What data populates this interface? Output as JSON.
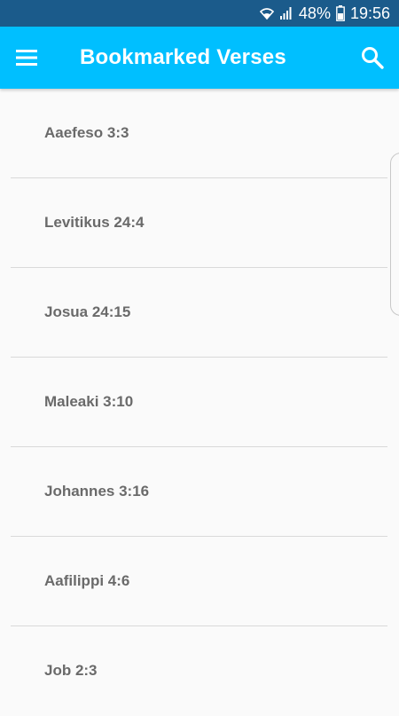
{
  "status_bar": {
    "battery_percent": "48%",
    "time": "19:56",
    "wifi_icon": "wifi-icon",
    "signal_icon": "signal-icon",
    "battery_icon": "battery-icon"
  },
  "app_bar": {
    "title": "Bookmarked Verses",
    "menu_icon": "menu-icon",
    "search_icon": "search-icon",
    "background_color": "#00bfff"
  },
  "bookmarks": [
    {
      "label": "Aaefeso 3:3"
    },
    {
      "label": "Levitikus 24:4"
    },
    {
      "label": "Josua 24:15"
    },
    {
      "label": "Maleaki 3:10"
    },
    {
      "label": "Johannes 3:16"
    },
    {
      "label": "Aafilippi 4:6"
    },
    {
      "label": "Job 2:3"
    }
  ]
}
